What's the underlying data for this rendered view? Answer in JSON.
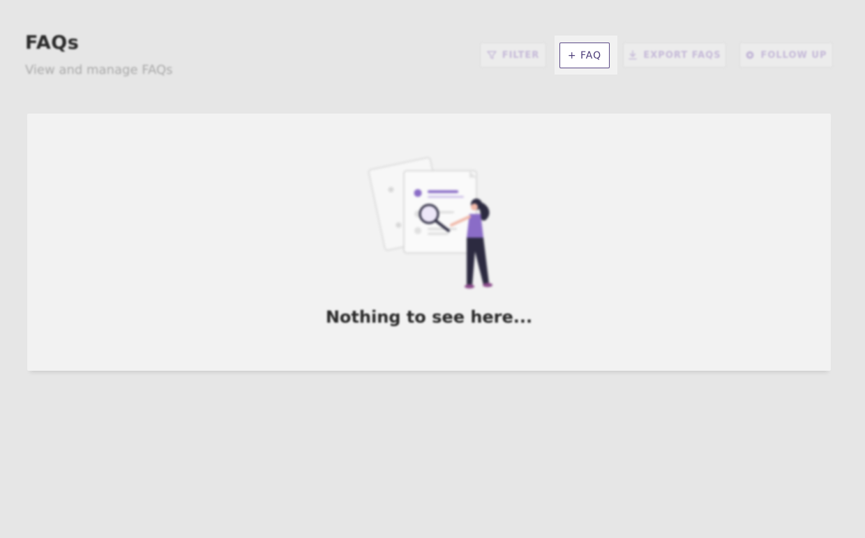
{
  "header": {
    "title": "FAQs",
    "subtitle": "View and manage FAQs"
  },
  "toolbar": {
    "filter_label": "FILTER",
    "add_label": "+ FAQ",
    "export_label": "EXPORT FAQS",
    "follow_up_label": "FOLLOW UP",
    "icons": {
      "filter": "filter-icon",
      "export": "download-icon",
      "follow_up": "gear-icon"
    }
  },
  "empty_state": {
    "message": "Nothing to see here...",
    "illustration": "person-with-magnifier-and-documents"
  },
  "colors": {
    "accent": "#4b3b78",
    "accent_light": "#8a6cc7",
    "background": "#e6e6e6",
    "card": "#f2f2f2"
  }
}
